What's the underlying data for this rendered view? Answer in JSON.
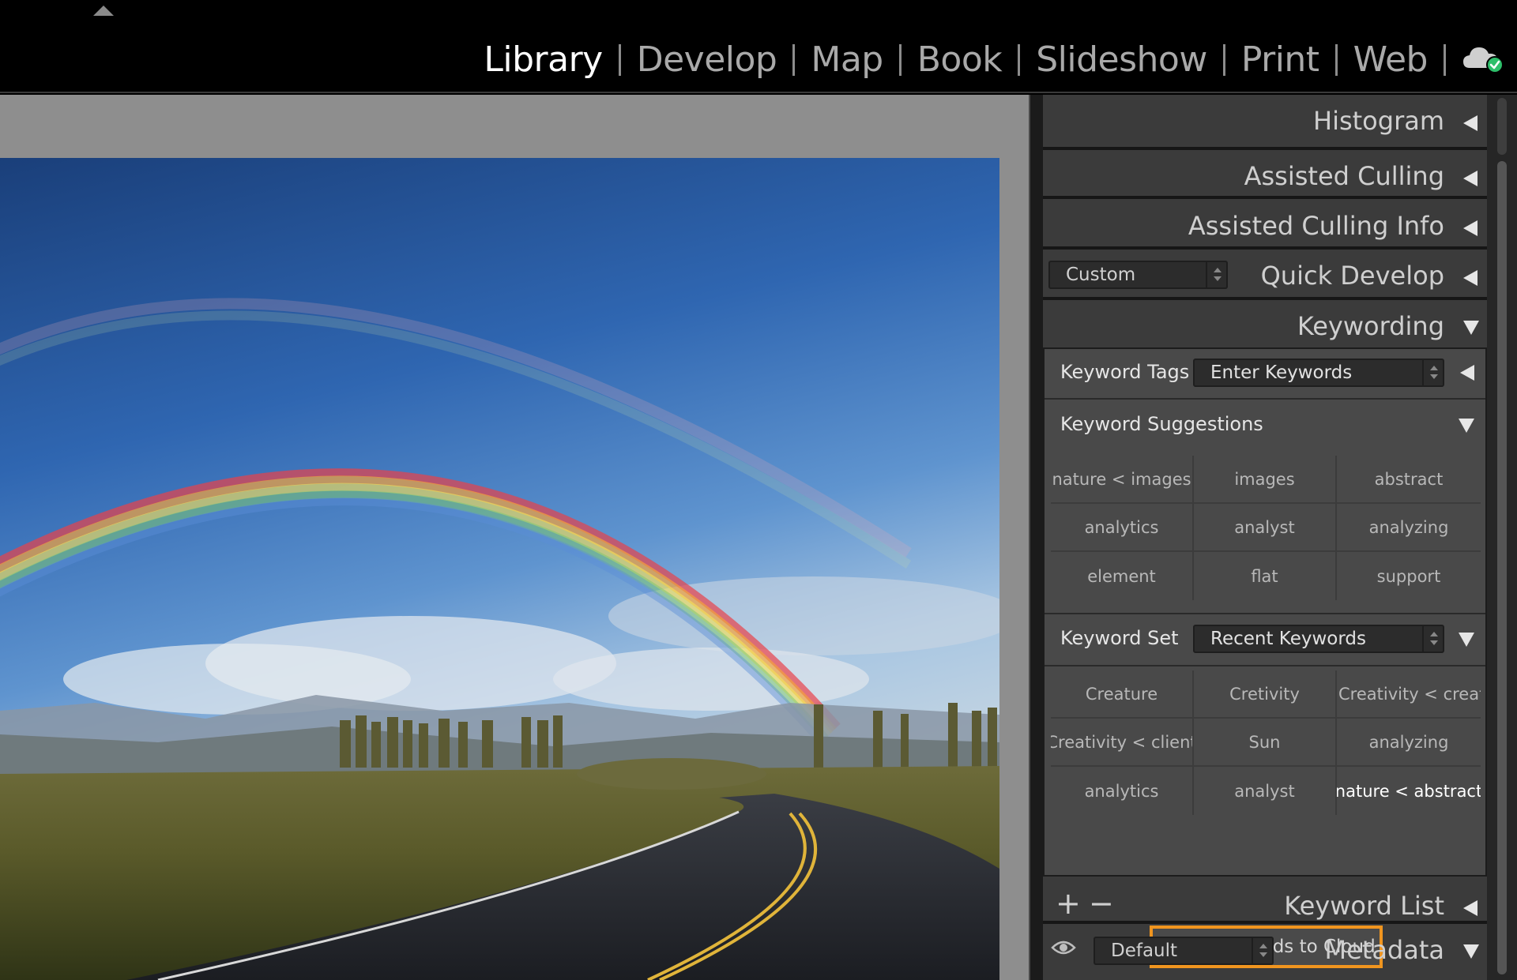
{
  "modules": {
    "items": [
      "Library",
      "Develop",
      "Map",
      "Book",
      "Slideshow",
      "Print",
      "Web"
    ],
    "active": "Library"
  },
  "icons": {
    "filmstrip_toggle": "triangle-up-icon",
    "cloud_sync": "cloud-sync-icon",
    "metadata_eye": "eye-icon"
  },
  "colors": {
    "highlight_border": "#f0951f",
    "cloud_status": "#2dbf6a"
  },
  "panels": {
    "histogram": "Histogram",
    "assisted_culling": "Assisted Culling",
    "assisted_culling_info": "Assisted Culling Info",
    "quick_develop": {
      "title": "Quick Develop",
      "preset": "Custom"
    },
    "keywording": {
      "title": "Keywording",
      "keyword_tags": {
        "label": "Keyword Tags",
        "value": "Enter Keywords"
      },
      "suggestions": {
        "label": "Keyword Suggestions",
        "items": [
          "nature < images",
          "images",
          "abstract",
          "analytics",
          "analyst",
          "analyzing",
          "element",
          "flat",
          "support"
        ]
      },
      "keyword_set": {
        "label": "Keyword Set",
        "value": "Recent Keywords",
        "items": [
          "Creature",
          "Cretivity",
          "Creativity < creative",
          "Creativity < client",
          "Sun",
          "analyzing",
          "analytics",
          "analyst",
          "nature < abstract"
        ]
      },
      "sync_button": "Sync Keywords to Cloud"
    },
    "keyword_list": {
      "title": "Keyword List",
      "add": "+",
      "remove": "−"
    },
    "metadata": {
      "title": "Metadata",
      "preset": "Default"
    }
  }
}
